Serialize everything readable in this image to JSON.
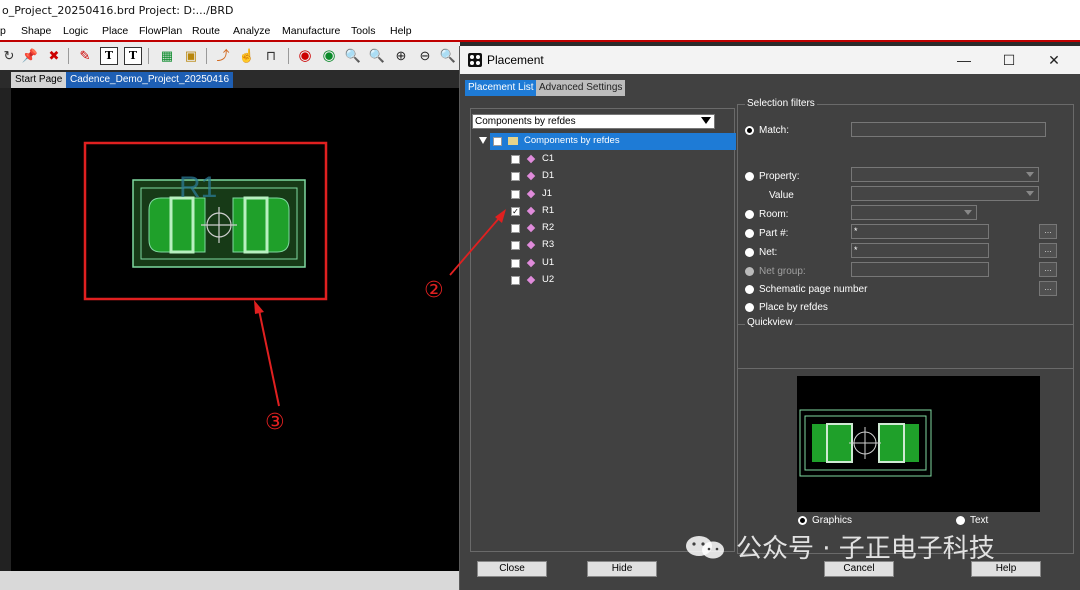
{
  "window": {
    "title": "o_Project_20250416.brd  Project: D:.../BRD"
  },
  "menu": [
    "p",
    "Shape",
    "Logic",
    "Place",
    "FlowPlan",
    "Route",
    "Analyze",
    "Manufacture",
    "Tools",
    "Help"
  ],
  "toolbar": {
    "text_tool_label": "T"
  },
  "tabs": {
    "start": "Start Page",
    "design": "Cadence_Demo_Project_20250416"
  },
  "canvas": {
    "refdes_label": "R1"
  },
  "dialog": {
    "title": "Placement",
    "tabs": {
      "list": "Placement List",
      "advanced": "Advanced Settings"
    },
    "dropdown_value": "Components by refdes",
    "tree_root": "Components by refdes",
    "components": [
      {
        "label": "C1",
        "checked": false
      },
      {
        "label": "D1",
        "checked": false
      },
      {
        "label": "J1",
        "checked": false
      },
      {
        "label": "R1",
        "checked": true
      },
      {
        "label": "R2",
        "checked": false
      },
      {
        "label": "R3",
        "checked": false
      },
      {
        "label": "U1",
        "checked": false
      },
      {
        "label": "U2",
        "checked": false
      }
    ],
    "selection_filters": {
      "title": "Selection filters",
      "match": "Match:",
      "property": "Property:",
      "value": "Value",
      "room": "Room:",
      "part": "Part #:",
      "part_value": "*",
      "net": "Net:",
      "net_value": "*",
      "net_group": "Net group:",
      "schematic": "Schematic page number",
      "place_by_refdes": "Place by refdes",
      "dots": "..."
    },
    "quickview": {
      "title": "Quickview",
      "graphics": "Graphics",
      "text": "Text"
    },
    "buttons": {
      "close": "Close",
      "hide": "Hide",
      "cancel": "Cancel",
      "help": "Help"
    }
  },
  "annotations": {
    "two": "②",
    "three": "③"
  },
  "watermark": "公众号 · 子正电子科技",
  "colors": {
    "accent": "#1e7bd6",
    "annotation": "#e02020",
    "pad": "#1fa02a",
    "outline": "#7fd9a0"
  }
}
